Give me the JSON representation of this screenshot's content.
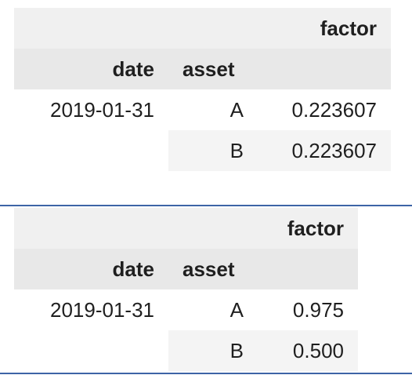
{
  "output_1": {
    "column_header": "factor",
    "index_names": [
      "date",
      "asset"
    ],
    "rows": [
      {
        "date": "2019-01-31",
        "asset": "A",
        "factor": "0.223607"
      },
      {
        "date": "",
        "asset": "B",
        "factor": "0.223607"
      }
    ]
  },
  "output_2": {
    "column_header": "factor",
    "index_names": [
      "date",
      "asset"
    ],
    "rows": [
      {
        "date": "2019-01-31",
        "asset": "A",
        "factor": "0.975"
      },
      {
        "date": "",
        "asset": "B",
        "factor": "0.500"
      }
    ]
  },
  "colors": {
    "divider": "#3d64a6",
    "header_bg": "#e8e8e8",
    "alt_row_bg": "#f4f4f4"
  }
}
